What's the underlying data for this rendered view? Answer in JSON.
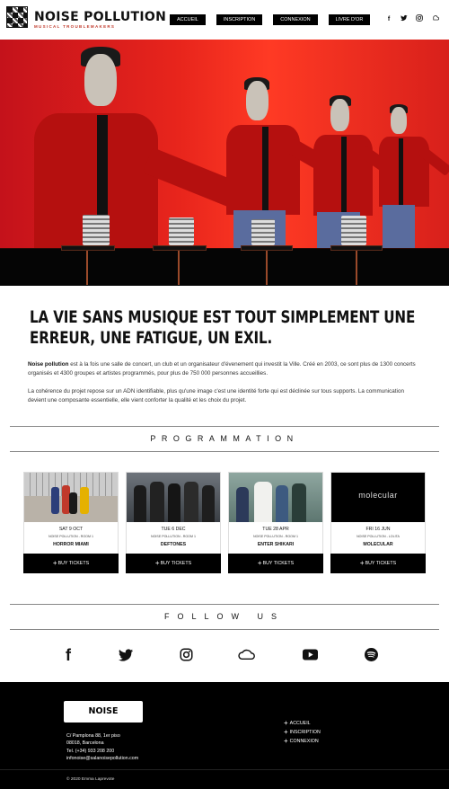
{
  "header": {
    "logo_text": "NOISE POLLUTION",
    "logo_sub": "MUSICAL TROUBLEMAKERS",
    "nav": [
      "ACCUEIL",
      "INSCRIPTION",
      "CONNEXION",
      "LIVRE D'OR"
    ],
    "social_icons": [
      "facebook-icon",
      "twitter-icon",
      "instagram-icon",
      "soundcloud-icon"
    ]
  },
  "intro": {
    "title": "LA VIE SANS MUSIQUE EST TOUT SIMPLEMENT UNE ERREUR, UNE FATIGUE, UN EXIL.",
    "p1_bold": "Noise pollution",
    "p1_rest": " est à la fois une salle de concert, un club et un organisateur d'évenement qui investit la Ville. Créé en 2003, ce sont plus de 1300 concerts organisés et 4300 groupes et artistes programmés, pour plus de 750 000 personnes accueillies.",
    "p2": "La cohérence du projet repose sur un ADN identifiable, plus qu'une image c'est une identité forte qui est déclinée sur tous supports. La communication devient une composante essentielle, elle vient conforter la qualité et les choix du projet."
  },
  "programmation": {
    "heading": "PROGRAMMATION",
    "buy_label": "BUY TICKETS",
    "events": [
      {
        "date": "SAT 9 OCT",
        "venue": "NOISE POLLUTION - ROOM 1",
        "name": "HORROR MIAMI"
      },
      {
        "date": "TUE 6 DEC",
        "venue": "NOISE POLLUTION - ROOM 1",
        "name": "DEFTONES"
      },
      {
        "date": "TUE 28 APR",
        "venue": "NOISE POLLUTION - ROOM 1",
        "name": "ENTER SHIKARI"
      },
      {
        "date": "FRI 16 JUN",
        "venue": "NOISE POLLUTION - LOLITA",
        "name": "MOLECULAR",
        "image_text": "molecular"
      }
    ]
  },
  "follow": {
    "heading": "FOLLOW US",
    "icons": [
      "facebook-icon",
      "twitter-icon",
      "instagram-icon",
      "soundcloud-icon",
      "youtube-icon",
      "spotify-icon"
    ]
  },
  "footer": {
    "logo_text": "NOISE POLLUTION",
    "address_lines": [
      "C/ Pamplona 88, 1er piso",
      "08018, Barcelona",
      "Tel. (+34) 933 208 200",
      "infonoise@salanoisepollution.com"
    ],
    "links": [
      "ACCUEIL",
      "INSCRIPTION",
      "CONNEXION"
    ],
    "copyright": "© 2020 Emma Laprevote"
  }
}
